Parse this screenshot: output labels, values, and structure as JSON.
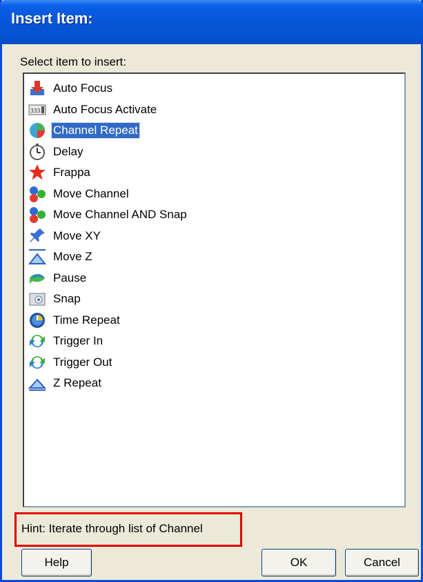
{
  "window": {
    "title": "Insert Item:"
  },
  "prompt": "Select item to insert:",
  "items": [
    {
      "label": "Auto Focus",
      "icon": "auto-focus-icon",
      "selected": false
    },
    {
      "label": "Auto Focus Activate",
      "icon": "auto-focus-activate-icon",
      "selected": false
    },
    {
      "label": "Channel Repeat",
      "icon": "channel-repeat-icon",
      "selected": true
    },
    {
      "label": "Delay",
      "icon": "clock-icon",
      "selected": false
    },
    {
      "label": "Frappa",
      "icon": "star-icon",
      "selected": false
    },
    {
      "label": "Move Channel",
      "icon": "move-channel-icon",
      "selected": false
    },
    {
      "label": "Move Channel AND Snap",
      "icon": "move-channel-snap-icon",
      "selected": false
    },
    {
      "label": "Move XY",
      "icon": "pushpin-icon",
      "selected": false
    },
    {
      "label": "Move Z",
      "icon": "move-z-icon",
      "selected": false
    },
    {
      "label": "Pause",
      "icon": "pause-icon",
      "selected": false
    },
    {
      "label": "Snap",
      "icon": "camera-icon",
      "selected": false
    },
    {
      "label": "Time Repeat",
      "icon": "time-repeat-icon",
      "selected": false
    },
    {
      "label": "Trigger In",
      "icon": "trigger-in-icon",
      "selected": false
    },
    {
      "label": "Trigger Out",
      "icon": "trigger-out-icon",
      "selected": false
    },
    {
      "label": "Z Repeat",
      "icon": "z-repeat-icon",
      "selected": false
    }
  ],
  "hint": "Hint: Iterate through list of Channel",
  "buttons": {
    "help": "Help",
    "ok": "OK",
    "cancel": "Cancel"
  },
  "colors": {
    "selection": "#316AC5",
    "titlebar": "#0756D8",
    "hint_border": "#E00000"
  }
}
